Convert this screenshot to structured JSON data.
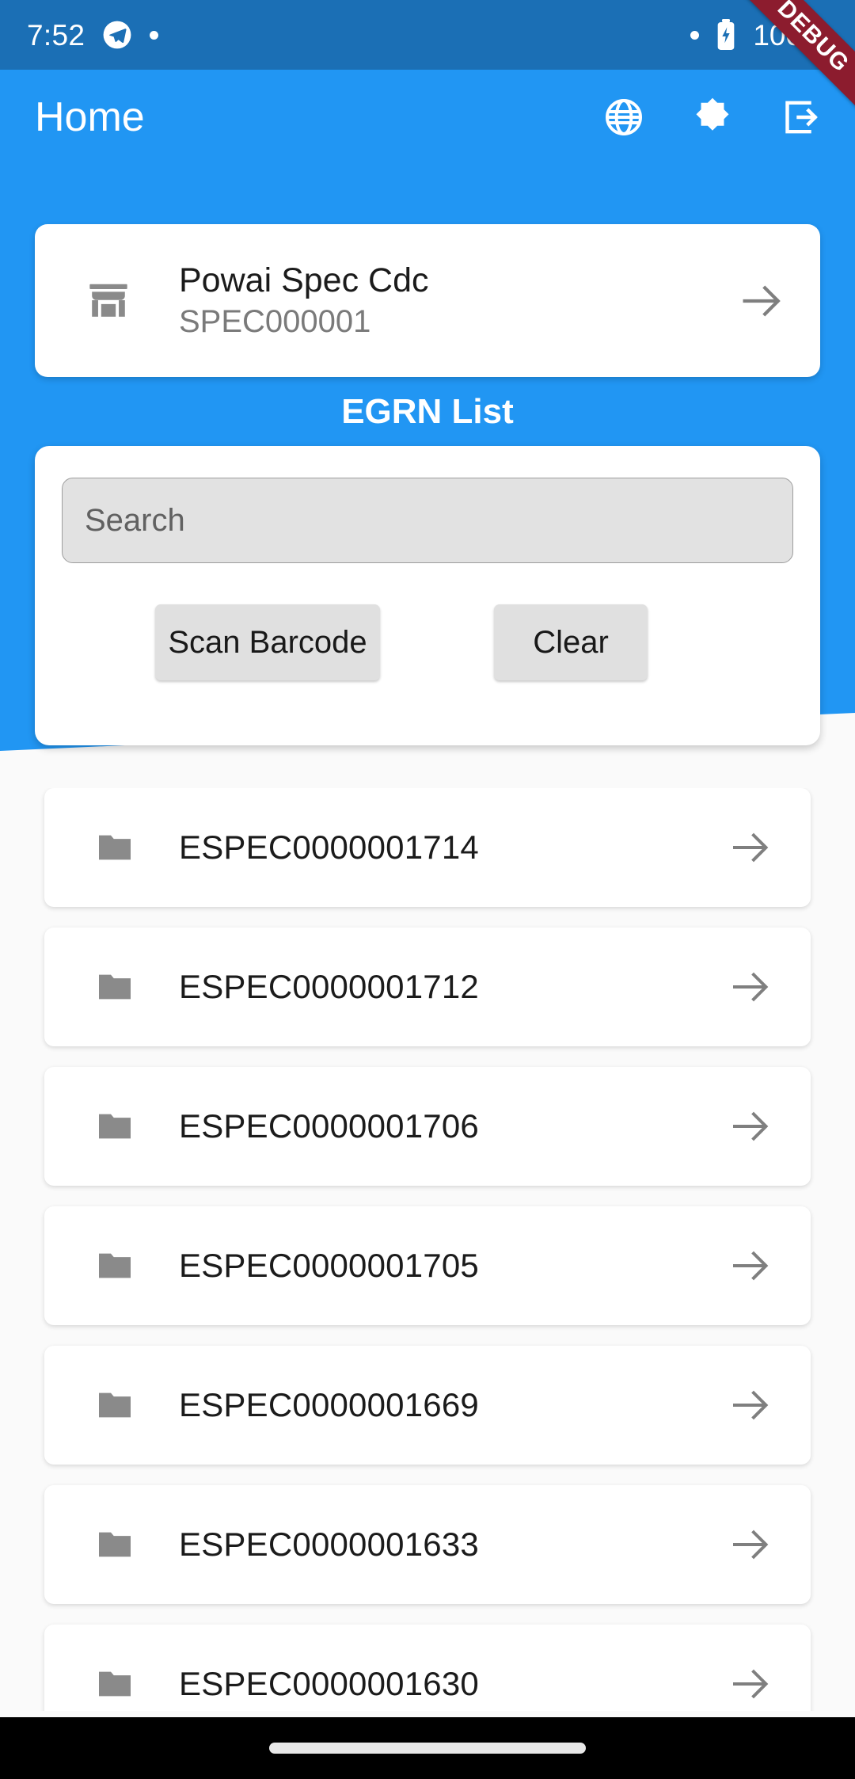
{
  "status_bar": {
    "time": "7:52",
    "battery_percent": "100%",
    "icons": [
      "telegram-icon",
      "notification-dot",
      "notification-dot-right",
      "battery-charging-icon"
    ]
  },
  "debug_ribbon": {
    "label": "DEBUG",
    "color": "#8c1c2e"
  },
  "app_bar": {
    "title": "Home",
    "background": "#2196f3",
    "actions": [
      {
        "name": "language-icon",
        "label": "globe-icon"
      },
      {
        "name": "dark-mode-icon",
        "label": "brightness-icon"
      },
      {
        "name": "logout-icon",
        "label": "logout-icon"
      }
    ]
  },
  "store_card": {
    "icon": "store-icon",
    "name": "Powai Spec Cdc",
    "code": "SPEC000001",
    "arrow": "arrow-right-icon"
  },
  "section": {
    "title": "EGRN List"
  },
  "search": {
    "placeholder": "Search",
    "value": "",
    "scan_label": "Scan Barcode",
    "clear_label": "Clear"
  },
  "list": {
    "items": [
      {
        "icon": "folder-icon",
        "code": "ESPEC0000001714"
      },
      {
        "icon": "folder-icon",
        "code": "ESPEC0000001712"
      },
      {
        "icon": "folder-icon",
        "code": "ESPEC0000001706"
      },
      {
        "icon": "folder-icon",
        "code": "ESPEC0000001705"
      },
      {
        "icon": "folder-icon",
        "code": "ESPEC0000001669"
      },
      {
        "icon": "folder-icon",
        "code": "ESPEC0000001633"
      },
      {
        "icon": "folder-icon",
        "code": "ESPEC0000001630"
      }
    ]
  }
}
